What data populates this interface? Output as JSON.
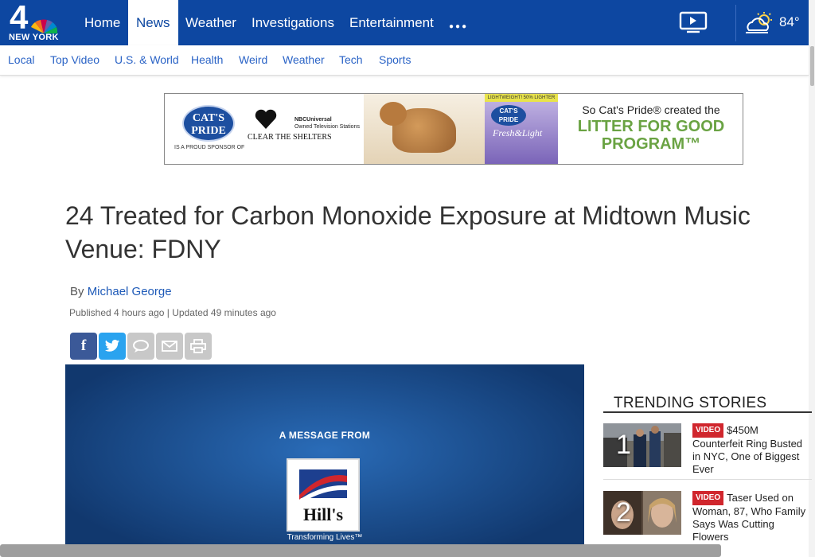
{
  "brand": {
    "channel_number": "4",
    "city": "NEW YORK"
  },
  "nav": {
    "items": [
      {
        "label": "Home",
        "active": false
      },
      {
        "label": "News",
        "active": true
      },
      {
        "label": "Weather",
        "active": false
      },
      {
        "label": "Investigations",
        "active": false
      },
      {
        "label": "Entertainment",
        "active": false
      }
    ],
    "more_icon": "ellipsis-icon",
    "video_icon": "play-screen-icon",
    "weather_icon": "partly-cloudy-icon",
    "temperature": "84°"
  },
  "subnav": {
    "items": [
      "Local",
      "Top Video",
      "U.S. & World",
      "Health",
      "Weird",
      "Weather",
      "Tech",
      "Sports"
    ]
  },
  "ad": {
    "brand": "CAT'S PRIDE",
    "sponsor_text": "IS A PROUD SPONSOR OF",
    "partner": "CLEAR THE SHELTERS",
    "nbc_line1": "NBCUniversal",
    "nbc_line2": "Owned Television Stations",
    "product_top": "LIGHTWEIGHT! 50% LIGHTER",
    "product_name": "Fresh&Light",
    "right_line1": "So Cat's Pride® created the",
    "right_line2": "LITTER FOR GOOD PROGRAM™"
  },
  "article": {
    "headline": "24 Treated for Carbon Monoxide Exposure at Midtown Music Venue: FDNY",
    "byline_prefix": "By",
    "author": "Michael George",
    "dateline": "Published 4 hours ago | Updated 49 minutes ago"
  },
  "share": {
    "buttons": [
      {
        "name": "facebook",
        "glyph": "f",
        "color": "#3b5998"
      },
      {
        "name": "twitter",
        "glyph": "t",
        "color": "#2aa3ef"
      },
      {
        "name": "comments",
        "glyph": "…",
        "color": "#c8c8c8"
      },
      {
        "name": "email",
        "glyph": "✉",
        "color": "#c8c8c8"
      },
      {
        "name": "print",
        "glyph": "⎙",
        "color": "#c8c8c8"
      }
    ]
  },
  "video": {
    "message": "A MESSAGE FROM",
    "sponsor": "Hill's",
    "tagline": "Transforming Lives™"
  },
  "trending": {
    "title": "TRENDING STORIES",
    "items": [
      {
        "rank": "1",
        "badge": "VIDEO",
        "text": "$450M Counterfeit Ring Busted in NYC, One of Biggest Ever"
      },
      {
        "rank": "2",
        "badge": "VIDEO",
        "text": "Taser Used on Woman, 87, Who Family Says Was Cutting Flowers"
      }
    ]
  },
  "colors": {
    "brand_blue": "#0d47a1",
    "link_blue": "#2a63c6",
    "badge_red": "#d0262d"
  }
}
